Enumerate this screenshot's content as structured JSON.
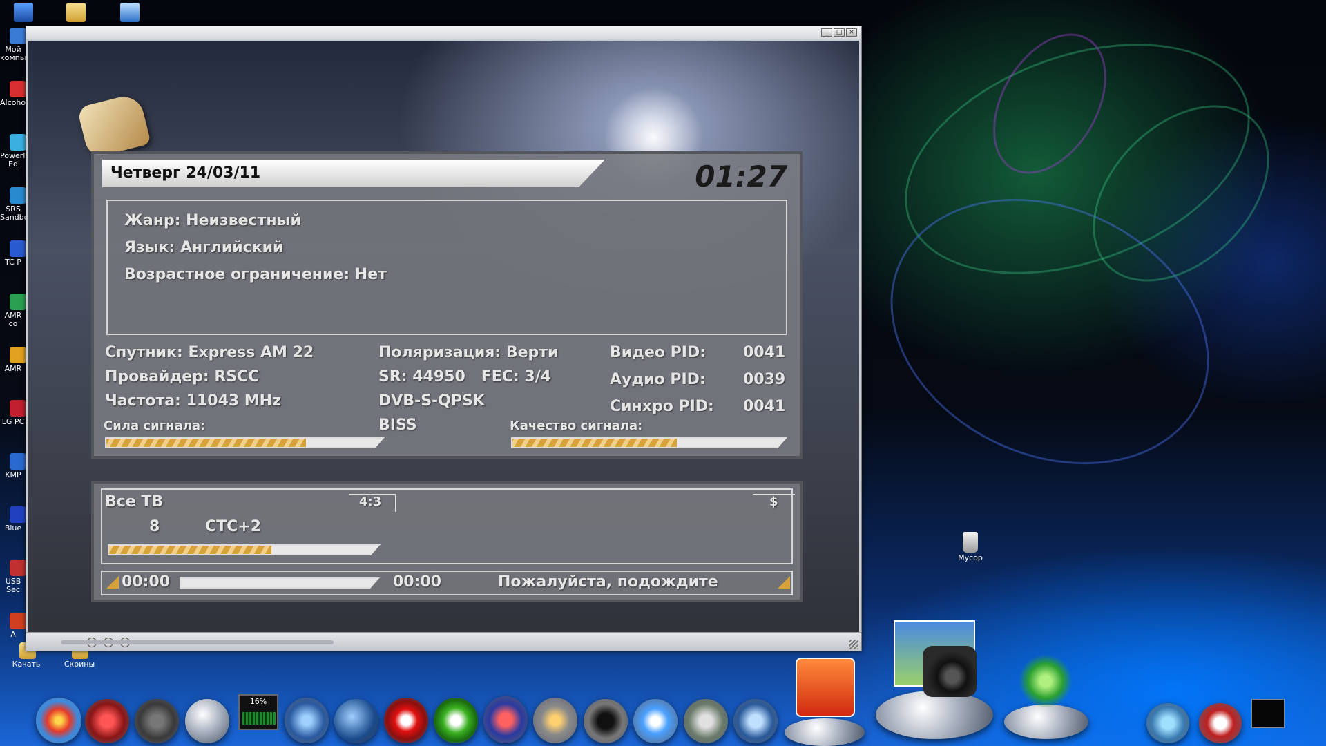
{
  "desktop": {
    "left_icons": [
      {
        "label": "Мой компьютер",
        "color": "#3a7bd5"
      },
      {
        "label": "Alcohol",
        "color": "#d83030"
      },
      {
        "label": "PowerISO Ed",
        "color": "#3ab0e0"
      },
      {
        "label": "SRS Sandbox",
        "color": "#2a8ad0"
      },
      {
        "label": "TC P",
        "color": "#2a5ad0"
      },
      {
        "label": "AMR co",
        "color": "#2aa050"
      },
      {
        "label": "AMR",
        "color": "#e0a020"
      },
      {
        "label": "LG PC",
        "color": "#c02030"
      },
      {
        "label": "KMP",
        "color": "#2a6ad0"
      },
      {
        "label": "Blue",
        "color": "#2040c0"
      },
      {
        "label": "USB Sec",
        "color": "#c03030"
      },
      {
        "label": "A",
        "color": "#d04020"
      }
    ],
    "bottom_icons": [
      {
        "label": "Качать"
      },
      {
        "label": "Скрины"
      }
    ],
    "recycle_bin": {
      "label": "Мусор"
    }
  },
  "player": {
    "window_buttons": [
      "_",
      "□",
      "×"
    ]
  },
  "osd": {
    "date": "Четверг 24/03/11",
    "time": "01:27",
    "info": {
      "genre": "Жанр: Неизвестный",
      "language": "Язык: Английский",
      "age": "Возрастное ограничение: Нет"
    },
    "satellite": "Спутник: Express AM 22",
    "provider": "Провайдер: RSCC",
    "frequency": "Частота: 11043 MHz",
    "polarization": "Поляризация: Верти",
    "sr_fec": "SR: 44950   FEC: 3/4",
    "modulation": "DVB-S-QPSK",
    "encryption": "BISS",
    "video_pid_label": "Видео PID:",
    "video_pid": "0041",
    "audio_pid_label": "Аудио PID:",
    "audio_pid": "0039",
    "sync_pid_label": "Синхро PID:",
    "sync_pid": "0041",
    "signal_strength_label": "Сила сигнала:",
    "signal_strength": 0.72,
    "signal_quality_label": "Качество сигнала:",
    "signal_quality": 0.6,
    "channel_list": "Все ТВ",
    "aspect": "4:3",
    "pay_badge": "$",
    "channel_number": "8",
    "channel_name": "СТС+2",
    "channel_signal": 0.6,
    "time_start": "00:00",
    "time_end": "00:00",
    "status": "Пожалуйста, подождите"
  },
  "taskbar": {
    "cpu_label": "16%",
    "items": [
      "start",
      "shutdown",
      "power",
      "clock",
      "cpu-monitor",
      "network",
      "globe",
      "opera",
      "utorrent",
      "save",
      "mixer",
      "speaker",
      "messenger",
      "device",
      "media",
      "acrobat",
      "camera",
      "recycle",
      "tray-1",
      "tray-2",
      "tray-3"
    ]
  }
}
